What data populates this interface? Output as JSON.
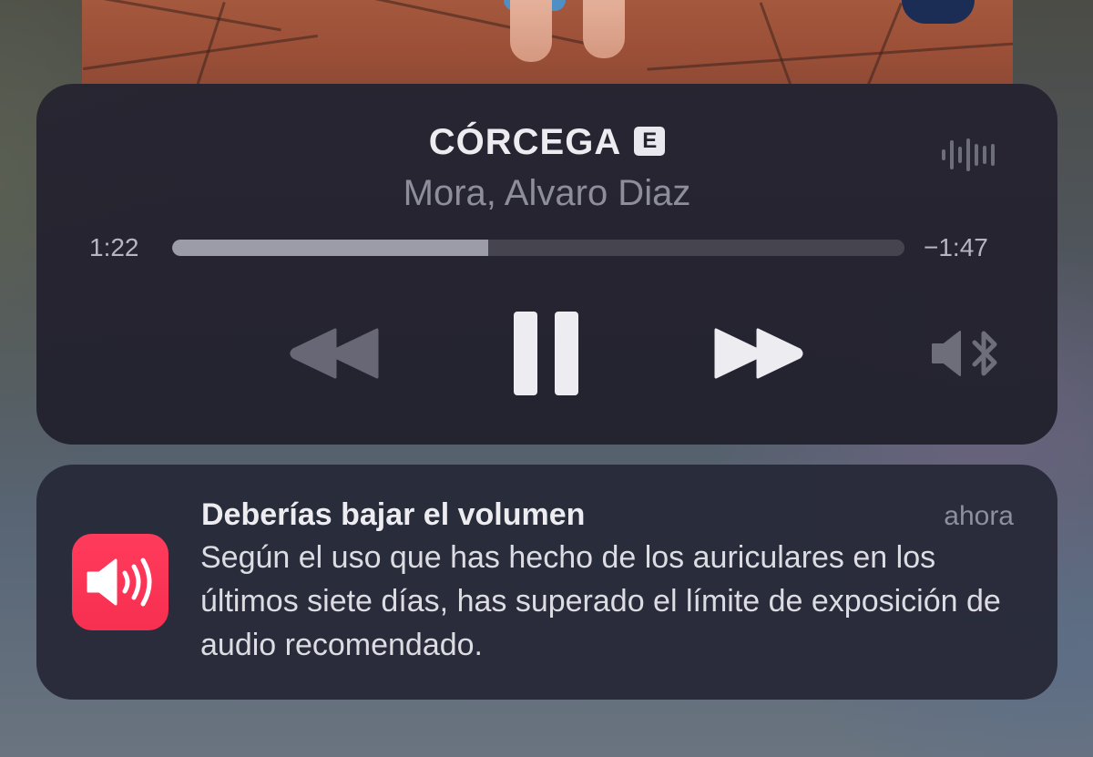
{
  "now_playing": {
    "title": "CÓRCEGA",
    "explicit_badge": "E",
    "artist": "Mora, Alvaro Diaz",
    "elapsed": "1:22",
    "remaining": "−1:47",
    "progress_fraction": 0.432,
    "icons": {
      "waveform": "waveform-icon",
      "rewind": "rewind-icon",
      "pause": "pause-icon",
      "forward": "fast-forward-icon",
      "output": "bluetooth-speaker-icon"
    },
    "colors": {
      "card": "#262430",
      "progress_fill": "#9c9ba8",
      "progress_track": "#45444f"
    }
  },
  "notification": {
    "title": "Deberías bajar el volumen",
    "time": "ahora",
    "body": "Según el uso que has hecho de los auriculares en los últimos siete días, has superado el límite de exposición de audio recomendado.",
    "icon": "speaker-volume-icon",
    "icon_color": "#ff3b5c"
  }
}
